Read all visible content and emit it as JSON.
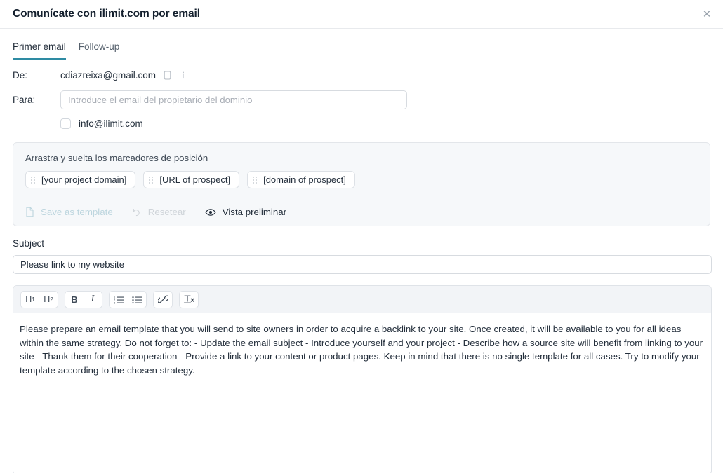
{
  "header": {
    "title": "Comunícate con ilimit.com por email",
    "close_label": "✕",
    "close_icon": "close-icon"
  },
  "tabs": [
    {
      "label": "Primer email",
      "active": true
    },
    {
      "label": "Follow-up",
      "active": false
    }
  ],
  "form": {
    "from": {
      "label": "De:",
      "value": "cdiazreixa@gmail.com",
      "copy_icon": "copy-icon",
      "info_icon": "info-icon"
    },
    "to": {
      "label": "Para:",
      "value": "",
      "placeholder": "Introduce el email del propietario del dominio"
    },
    "suggestion": {
      "checked": false,
      "label": "info@ilimit.com"
    }
  },
  "placeholders_panel": {
    "title": "Arrastra y suelta los marcadores de posición",
    "chips": [
      {
        "label": "[your project domain]"
      },
      {
        "label": "[URL of prospect]"
      },
      {
        "label": "[domain of prospect]"
      }
    ],
    "actions": [
      {
        "label": "Save as template",
        "icon": "file-icon",
        "state": "disabled-blue"
      },
      {
        "label": "Resetear",
        "icon": "undo-icon",
        "state": "disabled-gray"
      },
      {
        "label": "Vista preliminar",
        "icon": "eye-icon",
        "state": "enabled"
      }
    ]
  },
  "subject": {
    "label": "Subject",
    "value": "Please link to my website",
    "placeholder": "Subject"
  },
  "editor": {
    "toolbar": [
      {
        "name": "heading-1-button",
        "label": "H",
        "sub": "1",
        "kind": "heading"
      },
      {
        "name": "heading-2-button",
        "label": "H",
        "sub": "2",
        "kind": "heading"
      },
      {
        "name": "bold-button",
        "label": "B",
        "kind": "bold"
      },
      {
        "name": "italic-button",
        "label": "I",
        "kind": "italic"
      },
      {
        "name": "ordered-list-button",
        "label": "",
        "kind": "ol-icon"
      },
      {
        "name": "unordered-list-button",
        "label": "",
        "kind": "ul-icon"
      },
      {
        "name": "link-button",
        "label": "",
        "kind": "link-icon"
      },
      {
        "name": "clear-format-button",
        "label": "",
        "kind": "clear-format-icon"
      }
    ],
    "body": "Please prepare an email template that you will send to site owners in order to acquire a backlink to your site. Once created, it will be available to you for all ideas within the same strategy. Do not forget to: - Update the email subject - Introduce yourself and your project - Describe how a source site will benefit from linking to your site - Thank them for their cooperation - Provide a link to your content or product pages. Keep in mind that there is no single template for all cases. Try to modify your template according to the chosen strategy."
  },
  "colors": {
    "accent": "#2e8ba3",
    "panel_bg": "#f6f8fa",
    "toolbar_bg": "#f2f4f7",
    "border": "#dfe3e8",
    "text": "#1f2a37",
    "muted": "#a8adb5"
  }
}
